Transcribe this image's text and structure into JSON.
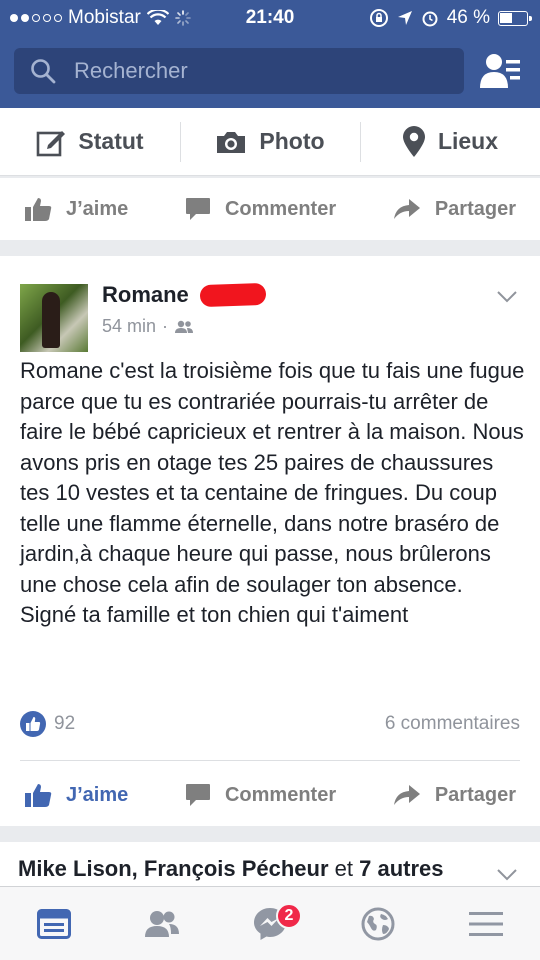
{
  "status_bar": {
    "carrier": "Mobistar",
    "time": "21:40",
    "battery": "46 %",
    "battery_level": 0.46
  },
  "search": {
    "placeholder": "Rechercher"
  },
  "composer": {
    "status_label": "Statut",
    "photo_label": "Photo",
    "places_label": "Lieux"
  },
  "top_actions": {
    "like_label": "J’aime",
    "comment_label": "Commenter",
    "share_label": "Partager"
  },
  "post": {
    "author": "Romane",
    "time": "54 min",
    "text": "Romane  c'est la  troisième fois que tu fais une fugue parce que tu es contrariée pourrais-tu arrêter de faire le bébé capricieux et rentrer à la maison. Nous avons pris en otage tes 25 paires de chaussures tes 10 vestes et ta centaine de fringues. Du coup telle une flamme éternelle, dans notre braséro de jardin,à chaque heure qui passe, nous brûlerons une chose cela afin de soulager ton absence.\nSigné ta famille et ton chien qui t'aiment",
    "like_count": "92",
    "comment_count": "6 commentaires",
    "like_label": "J’aime",
    "comment_label": "Commenter",
    "share_label": "Partager"
  },
  "next_post": {
    "names": "Mike Lison, François Pécheur",
    "connector": " et ",
    "others": "7 autres"
  },
  "tabbar": {
    "messenger_badge": "2"
  },
  "colors": {
    "brand": "#3b5998",
    "like_blue": "#4267b2",
    "badge_red": "#f02849"
  }
}
